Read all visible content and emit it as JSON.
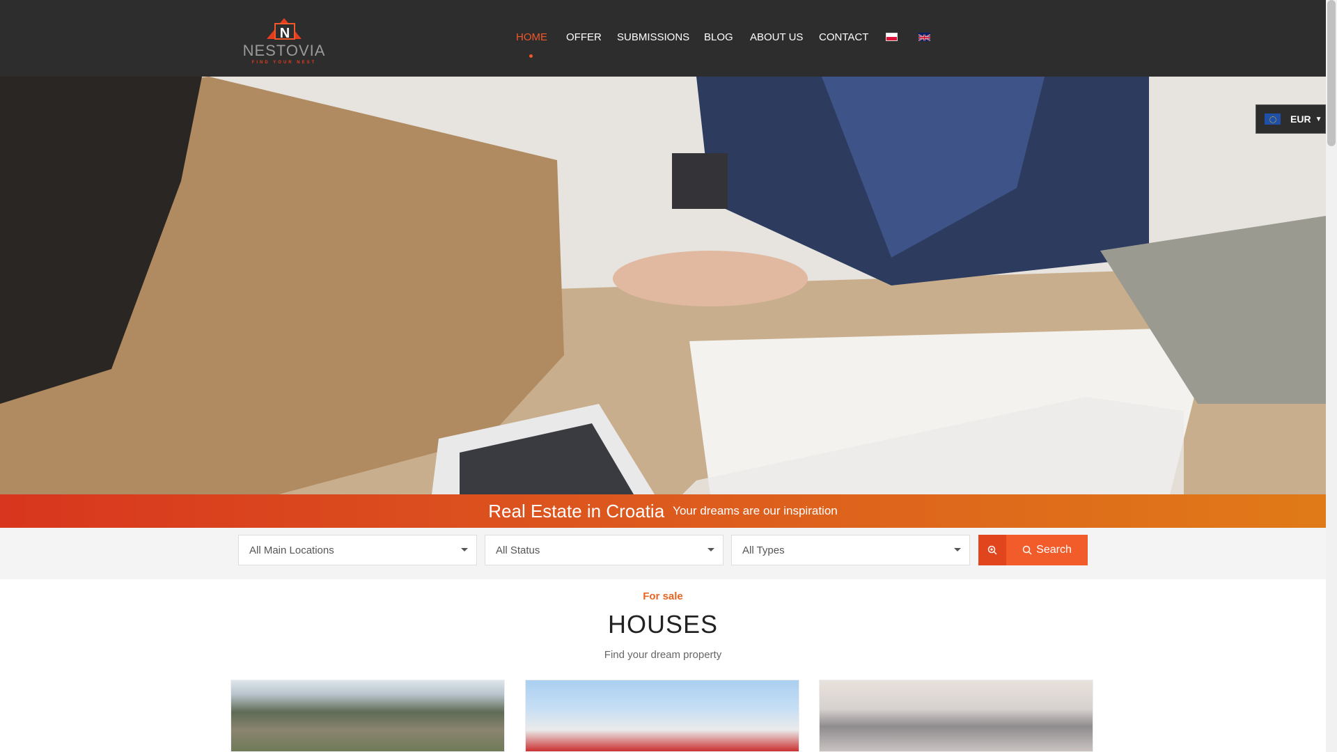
{
  "header": {
    "logo_text": "NESTOVIA",
    "logo_tagline": "FIND YOUR NEST",
    "nav": [
      {
        "label": "HOME",
        "active": true
      },
      {
        "label": "OFFER",
        "active": false
      },
      {
        "label": "SUBMISSIONS",
        "active": false
      },
      {
        "label": "BLOG",
        "active": false
      },
      {
        "label": "ABOUT US",
        "active": false
      },
      {
        "label": "CONTACT",
        "active": false
      }
    ],
    "languages": [
      "pl-flag-icon",
      "uk-flag-icon"
    ]
  },
  "currency": {
    "label": "EUR",
    "icon": "eu-flag-icon"
  },
  "banner": {
    "title": "Real Estate in Croatia",
    "subtitle": "Your dreams are our inspiration"
  },
  "search": {
    "location_value": "All Main Locations",
    "status_value": "All Status",
    "type_value": "All Types",
    "button_label": "Search"
  },
  "section": {
    "kicker": "For sale",
    "title": "HOUSES",
    "subtitle": "Find your dream property"
  },
  "colors": {
    "accent": "#f25c2a",
    "header_bg": "#2d2d2d",
    "active_nav": "#f0582a"
  }
}
